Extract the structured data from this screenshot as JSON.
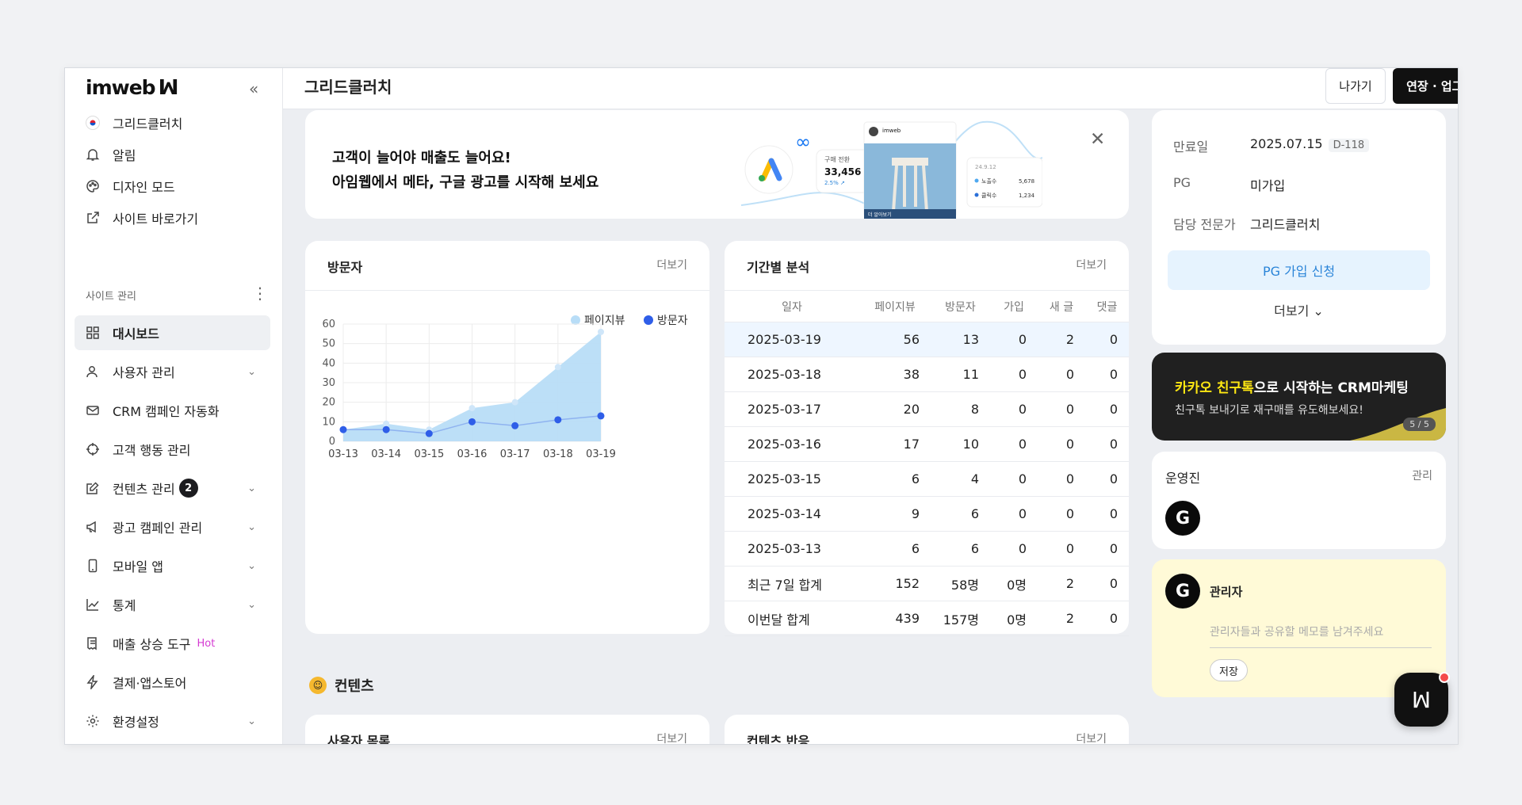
{
  "app": {
    "brand": "imweb",
    "site_name": "그리드클러치"
  },
  "topbar": {
    "title": "그리드클러치",
    "exit_label": "나가기",
    "upgrade_label": "연장 · 업그레이드"
  },
  "sidebar": {
    "collapse_icon": "double-chevron-left-icon",
    "top_items": [
      {
        "label": "그리드클러치",
        "icon": "korea-flag-icon"
      },
      {
        "label": "알림",
        "icon": "bell-icon"
      },
      {
        "label": "디자인 모드",
        "icon": "palette-icon"
      },
      {
        "label": "사이트 바로가기",
        "icon": "external-link-icon"
      }
    ],
    "section_label": "사이트 관리",
    "items": [
      {
        "label": "대시보드",
        "icon": "grid-icon",
        "active": true
      },
      {
        "label": "사용자 관리",
        "icon": "user-icon",
        "has_chevron": true
      },
      {
        "label": "CRM 캠페인 자동화",
        "icon": "mail-icon"
      },
      {
        "label": "고객 행동 관리",
        "icon": "crosshair-icon"
      },
      {
        "label": "컨텐츠 관리",
        "icon": "edit-icon",
        "badge": "2",
        "has_chevron": true
      },
      {
        "label": "광고 캠페인 관리",
        "icon": "megaphone-icon",
        "has_chevron": true
      },
      {
        "label": "모바일 앱",
        "icon": "mobile-icon",
        "has_chevron": true
      },
      {
        "label": "통계",
        "icon": "chart-line-icon",
        "has_chevron": true
      },
      {
        "label": "매출 상승 도구",
        "icon": "receipt-icon",
        "tag": "Hot"
      },
      {
        "label": "결제·앱스토어",
        "icon": "lightning-icon"
      },
      {
        "label": "환경설정",
        "icon": "gear-icon",
        "has_chevron": true
      }
    ]
  },
  "banner": {
    "line1": "고객이 늘어야 매출도 늘어요!",
    "line2": "아임웹에서 메타, 구글 광고를 시작해 보세요",
    "mock_conversion_label": "구매 전환",
    "mock_conversion_value": "33,456",
    "mock_conversion_change": "2.5% ↗",
    "mock_profile_name": "imweb",
    "mock_stat1_label": "노출수",
    "mock_stat1_value": "5,678",
    "mock_stat2_label": "클릭수",
    "mock_stat2_value": "1,234",
    "mock_date": "24.9.12",
    "mock_button": "더 알아보기"
  },
  "visitors": {
    "title": "방문자",
    "more": "더보기"
  },
  "chart_data": {
    "type": "area",
    "categories": [
      "03-13",
      "03-14",
      "03-15",
      "03-16",
      "03-17",
      "03-18",
      "03-19"
    ],
    "series": [
      {
        "name": "페이지뷰",
        "values": [
          6,
          9,
          6,
          17,
          20,
          38,
          56
        ],
        "color": "#b8ddf7"
      },
      {
        "name": "방문자",
        "values": [
          6,
          6,
          4,
          10,
          8,
          11,
          13
        ],
        "color": "#2f5ee8"
      }
    ],
    "ylim": [
      0,
      60
    ],
    "yticks": [
      0,
      10,
      20,
      30,
      40,
      50,
      60
    ],
    "grid": true,
    "legend": "top-right"
  },
  "periods": {
    "title": "기간별 분석",
    "more": "더보기",
    "headers": [
      "일자",
      "페이지뷰",
      "방문자",
      "가입",
      "새 글",
      "댓글"
    ],
    "rows": [
      [
        "2025-03-19",
        "56",
        "13",
        "0",
        "2",
        "0"
      ],
      [
        "2025-03-18",
        "38",
        "11",
        "0",
        "0",
        "0"
      ],
      [
        "2025-03-17",
        "20",
        "8",
        "0",
        "0",
        "0"
      ],
      [
        "2025-03-16",
        "17",
        "10",
        "0",
        "0",
        "0"
      ],
      [
        "2025-03-15",
        "6",
        "4",
        "0",
        "0",
        "0"
      ],
      [
        "2025-03-14",
        "9",
        "6",
        "0",
        "0",
        "0"
      ],
      [
        "2025-03-13",
        "6",
        "6",
        "0",
        "0",
        "0"
      ],
      [
        "최근 7일 합계",
        "152",
        "58명",
        "0명",
        "2",
        "0"
      ],
      [
        "이번달 합계",
        "439",
        "157명",
        "0명",
        "2",
        "0"
      ]
    ]
  },
  "contents": {
    "heading": "컨텐츠",
    "users_title": "사용자 목록",
    "users_more": "더보기",
    "reactions_title": "컨텐츠 반응",
    "reactions_more": "더보기"
  },
  "info": {
    "rows": [
      {
        "key": "만료일",
        "value": "2025.07.15",
        "dday": "D-118"
      },
      {
        "key": "PG",
        "value": "미가입"
      },
      {
        "key": "담당 전문가",
        "value": "그리드클러치"
      }
    ],
    "pg_button": "PG 가입 신청",
    "more": "더보기"
  },
  "kakao": {
    "highlight": "카카오 친구톡",
    "title_rest": "으로 시작하는 CRM마케팅",
    "sub": "친구톡 보내기로 재구매를 유도해보세요!",
    "page": "5 / 5"
  },
  "staff": {
    "title": "운영진",
    "manage": "관리",
    "avatar_letter": "G"
  },
  "memo": {
    "author": "관리자",
    "placeholder": "관리자들과 공유할 메모를 남겨주세요",
    "save": "저장",
    "avatar_letter": "G"
  }
}
